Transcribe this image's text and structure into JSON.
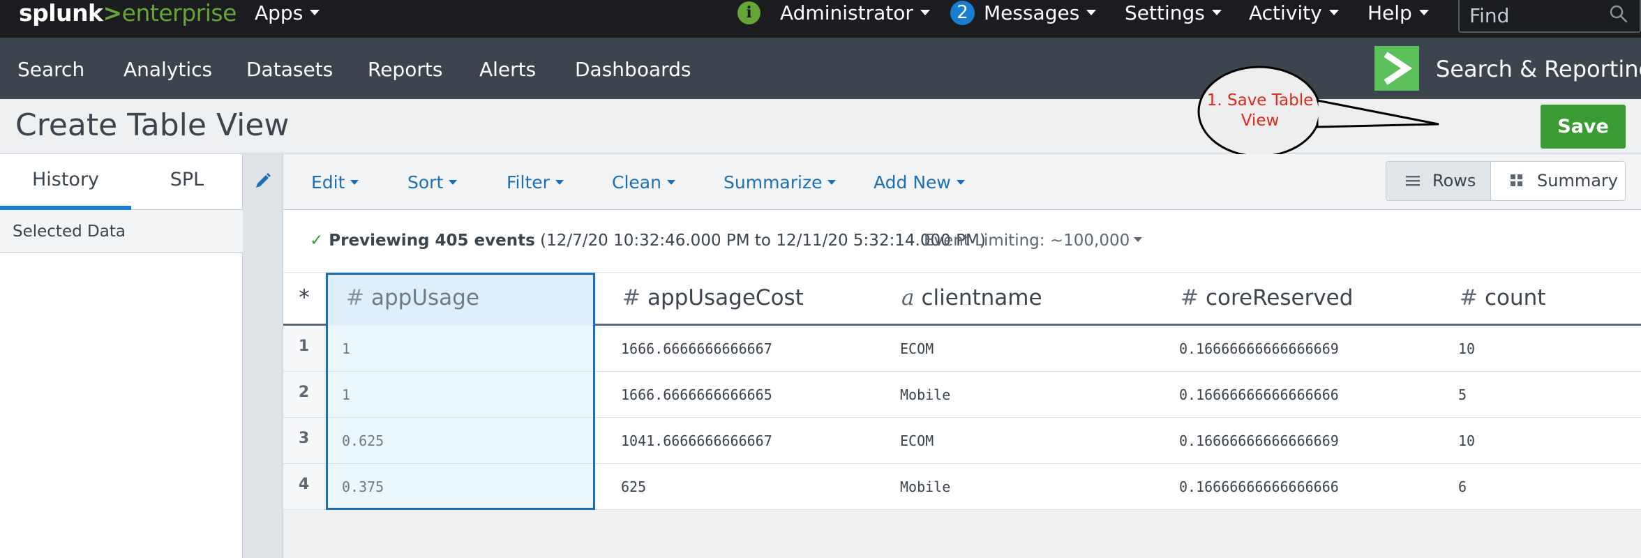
{
  "topbar": {
    "logo_main": "splunk",
    "logo_chevron": ">",
    "logo_sub": "enterprise",
    "apps_label": "Apps",
    "info_glyph": "i",
    "admin_label": "Administrator",
    "messages_count": "2",
    "messages_label": "Messages",
    "settings_label": "Settings",
    "activity_label": "Activity",
    "help_label": "Help",
    "find_placeholder": "Find"
  },
  "appbar": {
    "nav": [
      "Search",
      "Analytics",
      "Datasets",
      "Reports",
      "Alerts",
      "Dashboards"
    ],
    "app_title": "Search & Reporting"
  },
  "titlebar": {
    "title": "Create Table View",
    "save_label": "Save"
  },
  "callout": {
    "text": "1. Save Table View",
    "color": "#e0271c"
  },
  "leftpanel": {
    "tabs": [
      "History",
      "SPL"
    ],
    "selected_data": "Selected Data"
  },
  "toolbar": {
    "items": [
      "Edit",
      "Sort",
      "Filter",
      "Clean",
      "Summarize",
      "Add New"
    ],
    "rows_label": "Rows",
    "summary_label": "Summary"
  },
  "preview": {
    "check": "✓",
    "bold": "Previewing 405 events",
    "range": "(12/7/20 10:32:46.000 PM to 12/11/20 5:32:14.000 PM)",
    "event_limiting": "Event Limiting: ~100,000"
  },
  "table": {
    "star": "*",
    "columns": [
      {
        "type": "#",
        "name": "appUsage"
      },
      {
        "type": "#",
        "name": "appUsageCost"
      },
      {
        "type": "a",
        "name": "clientname"
      },
      {
        "type": "#",
        "name": "coreReserved"
      },
      {
        "type": "#",
        "name": "count"
      }
    ],
    "rows": [
      {
        "n": "1",
        "cells": [
          "1",
          "1666.6666666666667",
          "ECOM",
          "0.16666666666666669",
          "10"
        ]
      },
      {
        "n": "2",
        "cells": [
          "1",
          "1666.6666666666665",
          "Mobile",
          "0.16666666666666666",
          "5"
        ]
      },
      {
        "n": "3",
        "cells": [
          "0.625",
          "1041.6666666666667",
          "ECOM",
          "0.16666666666666669",
          "10"
        ]
      },
      {
        "n": "4",
        "cells": [
          "0.375",
          "625",
          "Mobile",
          "0.16666666666666666",
          "6"
        ]
      }
    ]
  },
  "colors": {
    "topbar": "#1a1c20",
    "appbar": "#3c444d",
    "accent_green": "#65a637",
    "save_green": "#3b9c35",
    "link_blue": "#1a6fb5"
  }
}
